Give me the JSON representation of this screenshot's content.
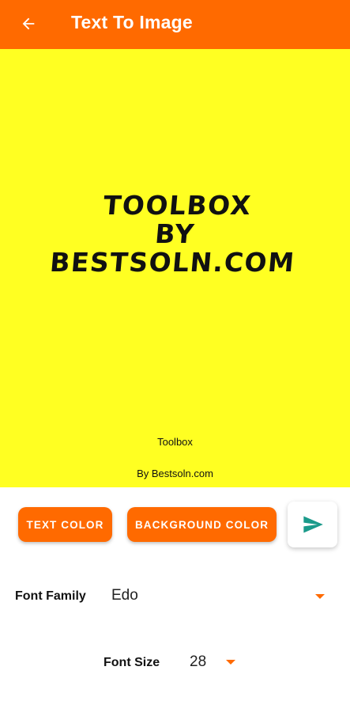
{
  "appbar": {
    "title": "Text To Image",
    "back_icon": "arrow-back-icon",
    "background_color": "#FF6A00"
  },
  "preview": {
    "background_color": "#FFFF22",
    "main_lines": [
      "TOOLBOX",
      "BY",
      "BESTSOLN.COM"
    ],
    "caption_line1": "Toolbox",
    "caption_line2": "By Bestsoln.com"
  },
  "buttons": {
    "text_color_label": "TEXT COLOR",
    "background_color_label": "BACKGROUND COLOR",
    "send_icon": "send-icon",
    "accent_color": "#FF6A00",
    "send_icon_color": "#1A9A8A"
  },
  "font_family": {
    "label": "Font Family",
    "value": "Edo",
    "caret_icon": "dropdown-caret-icon"
  },
  "font_size": {
    "label": "Font Size",
    "value": "28",
    "caret_icon": "dropdown-caret-icon"
  }
}
